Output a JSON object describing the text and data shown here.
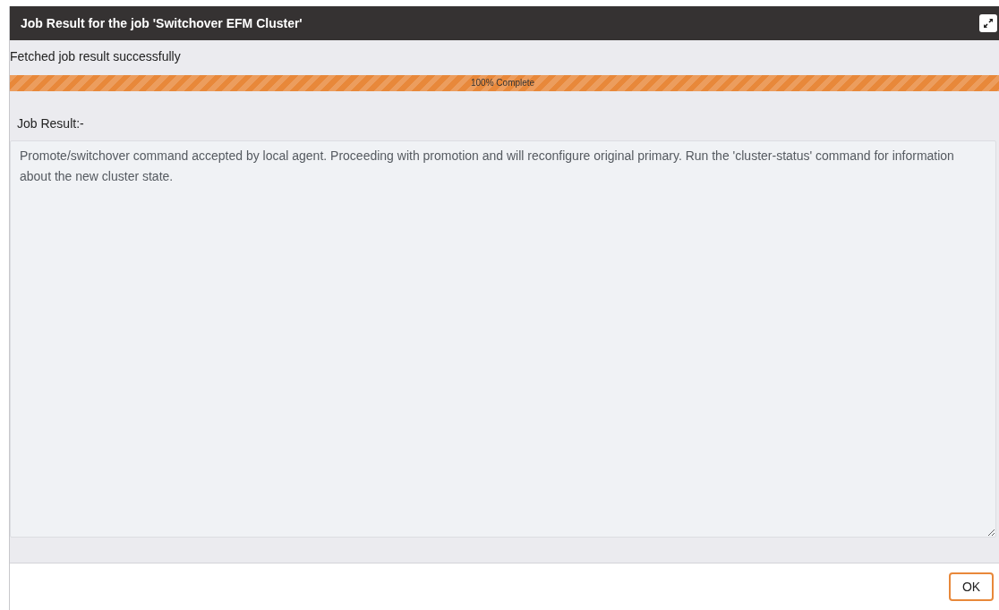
{
  "dialog": {
    "title": "Job Result for the job 'Switchover EFM Cluster'"
  },
  "status_message": "Fetched job result successfully",
  "progress": {
    "level": 1,
    "label": "100% Complete"
  },
  "result_label": "Job Result:-",
  "result_text": "Promote/switchover command accepted by local agent. Proceeding with promotion and will reconfigure original primary. Run the 'cluster-status' command for information about the new cluster state.",
  "buttons": [
    "OK"
  ]
}
